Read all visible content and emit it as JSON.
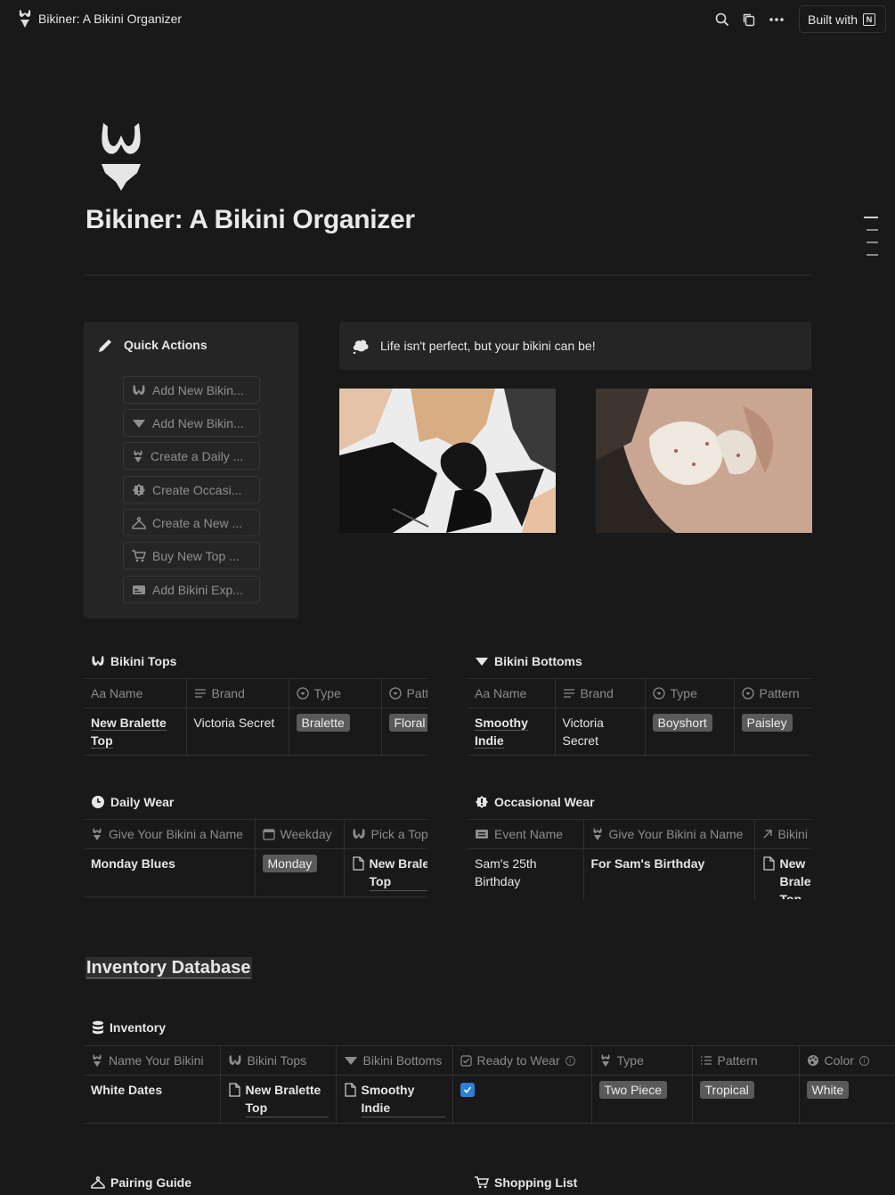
{
  "app": {
    "title": "Bikiner: A Bikini Organizer",
    "built_with": "Built with"
  },
  "page": {
    "title": "Bikiner: A Bikini Organizer"
  },
  "quick_actions": {
    "title": "Quick Actions",
    "buttons": [
      {
        "label": "Add New Bikin...",
        "icon": "bikini-top-icon"
      },
      {
        "label": "Add New Bikin...",
        "icon": "bikini-bottom-icon"
      },
      {
        "label": "Create a Daily ...",
        "icon": "bikini-set-icon"
      },
      {
        "label": "Create Occasi...",
        "icon": "badge-icon"
      },
      {
        "label": "Create a New ...",
        "icon": "hanger-icon"
      },
      {
        "label": "Buy New Top ...",
        "icon": "cart-icon"
      },
      {
        "label": "Add Bikini Exp...",
        "icon": "card-icon"
      }
    ]
  },
  "callout": {
    "text": "Life isn't perfect, but your bikini can be!"
  },
  "bikini_tops": {
    "title": "Bikini Tops",
    "columns": [
      "Aa Name",
      "Brand",
      "Type",
      "Pattern"
    ],
    "rows": [
      {
        "name": "New Bralette Top",
        "brand": "Victoria Secret",
        "type": "Bralette",
        "pattern": "Floral"
      }
    ]
  },
  "bikini_bottoms": {
    "title": "Bikini Bottoms",
    "columns": [
      "Aa Name",
      "Brand",
      "Type",
      "Pattern"
    ],
    "rows": [
      {
        "name": "Smoothy Indie",
        "brand": "Victoria Secret",
        "type": "Boyshort",
        "pattern": "Paisley"
      }
    ]
  },
  "daily_wear": {
    "title": "Daily Wear",
    "columns": [
      "Give Your Bikini a Name",
      "Weekday",
      "Pick a Top"
    ],
    "rows": [
      {
        "name": "Monday Blues",
        "weekday": "Monday",
        "top": "New Bralette Top"
      }
    ]
  },
  "occasional_wear": {
    "title": "Occasional Wear",
    "columns": [
      "Event Name",
      "Give Your Bikini a Name",
      "Bikini"
    ],
    "rows": [
      {
        "event": "Sam's 25th Birthday",
        "name": "For Sam's Birthday",
        "bikini": "New Bralette Top"
      }
    ]
  },
  "inventory_section": {
    "heading": "Inventory Database"
  },
  "inventory": {
    "title": "Inventory",
    "columns": [
      "Name Your Bikini",
      "Bikini Tops",
      "Bikini Bottoms",
      "Ready to Wear",
      "Type",
      "Pattern",
      "Color"
    ],
    "rows": [
      {
        "name": "White Dates",
        "top": "New Bralette Top",
        "bottom": "Smoothy Indie",
        "ready": true,
        "type": "Two Piece",
        "pattern": "Tropical",
        "color": "White"
      }
    ]
  },
  "bottom_sections": {
    "pairing": "Pairing Guide",
    "shopping": "Shopping List"
  }
}
